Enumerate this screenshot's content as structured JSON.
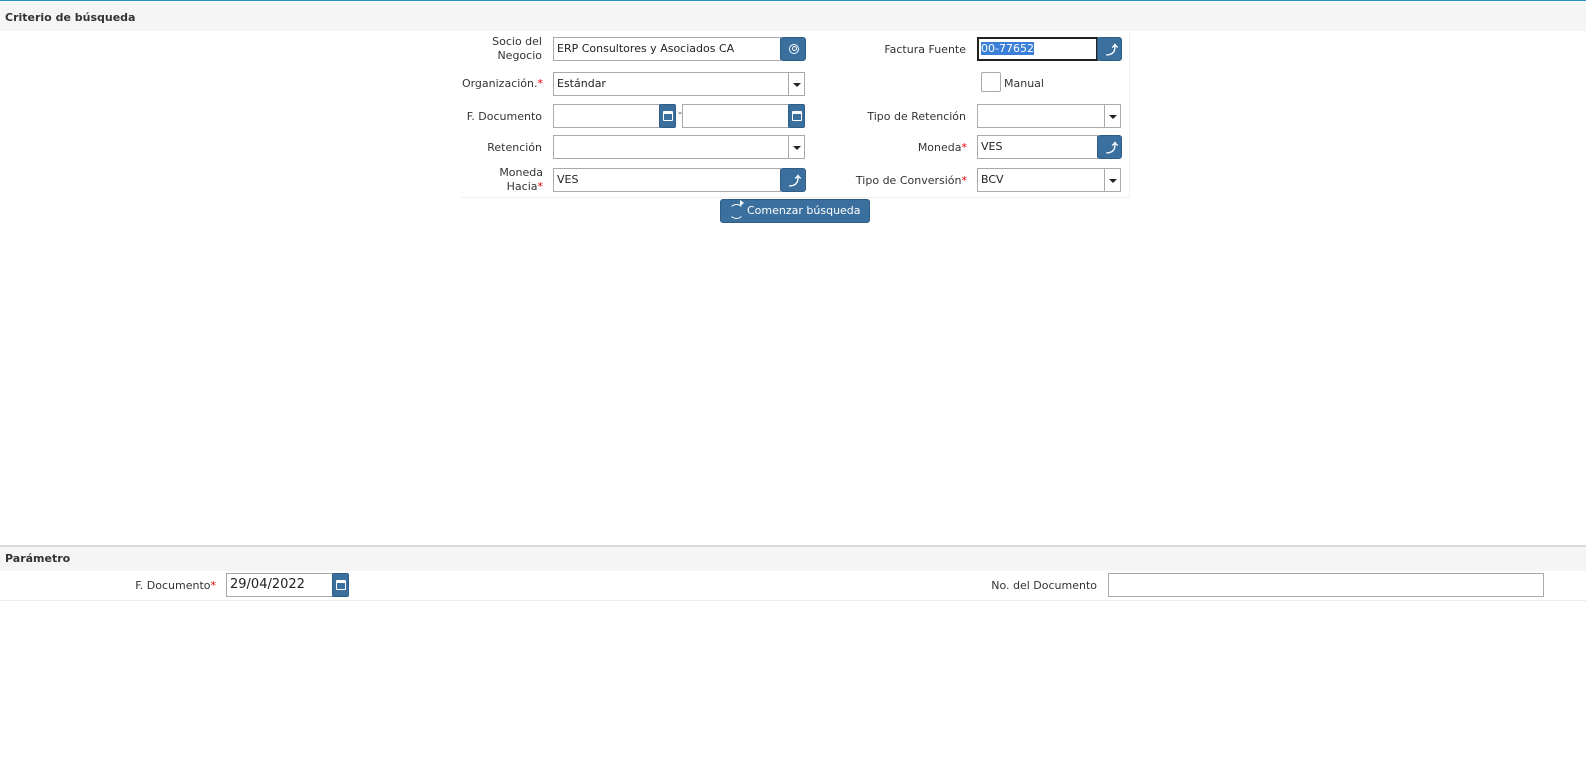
{
  "criteria": {
    "title": "Criterio de búsqueda",
    "business_partner": {
      "label_line1": "Socio del",
      "label_line2": "Negocio",
      "value": "ERP Consultores y Asociados CA"
    },
    "organization": {
      "label": "Organización.",
      "value": "Estándar"
    },
    "doc_date": {
      "label": "F. Documento",
      "from": "",
      "to": "",
      "separator": "-"
    },
    "withholding": {
      "label": "Retención",
      "value": ""
    },
    "currency_to": {
      "label_line1": "Moneda",
      "label_line2": "Hacia",
      "value": "VES"
    },
    "source_invoice": {
      "label": "Factura Fuente",
      "value": "00-77652"
    },
    "manual": {
      "label": "Manual",
      "checked": false
    },
    "withholding_type": {
      "label": "Tipo de Retención",
      "value": ""
    },
    "currency": {
      "label": "Moneda",
      "value": "VES"
    },
    "conversion_type": {
      "label": "Tipo de Conversión",
      "value": "BCV"
    },
    "required_mark": "*",
    "search_button": "Comenzar búsqueda ..."
  },
  "params": {
    "title": "Parámetro",
    "doc_date": {
      "label": "F. Documento",
      "value": "29/04/2022"
    },
    "doc_no": {
      "label": "No. del Documento",
      "value": ""
    },
    "required_mark": "*"
  },
  "icons": {
    "accent_color": "#3a6f9e",
    "top_line_color": "#2a8dbf"
  }
}
